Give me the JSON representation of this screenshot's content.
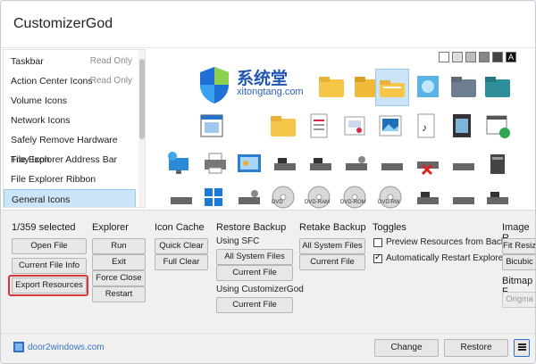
{
  "window": {
    "title": "CustomizerGod"
  },
  "watermark": {
    "brand": "系统堂",
    "url": "xitongtang.com"
  },
  "list": {
    "items": [
      {
        "label": "Taskbar",
        "badge": "Read Only"
      },
      {
        "label": "Action Center Icons",
        "badge": "Read Only"
      },
      {
        "label": "Volume Icons",
        "badge": ""
      },
      {
        "label": "Network Icons",
        "badge": ""
      },
      {
        "label": "Safely Remove Hardware Tray Icon",
        "badge": ""
      },
      {
        "label": "File Explorer Address Bar",
        "badge": ""
      },
      {
        "label": "File Explorer Ribbon",
        "badge": ""
      },
      {
        "label": "General Icons",
        "badge": "",
        "selected": true
      }
    ]
  },
  "size_buttons": [
    "",
    "",
    "",
    "",
    "",
    "A"
  ],
  "icon_labels": [
    "DVD",
    "DVD-RAM",
    "DVD-ROM",
    "DVD-RW"
  ],
  "panel": {
    "counter": "1/359 selected",
    "left_buttons": {
      "open": "Open File",
      "info": "Current File Info",
      "export": "Export Resources"
    },
    "explorer": {
      "title": "Explorer",
      "run": "Run",
      "exit": "Exit",
      "force_close": "Force Close",
      "restart": "Restart"
    },
    "icon_cache": {
      "title": "Icon Cache",
      "quick": "Quick Clear",
      "full": "Full Clear"
    },
    "restore_backup": {
      "title": "Restore Backup",
      "using_sfc": "Using SFC",
      "all_system": "All System Files",
      "current": "Current File",
      "using_cg": "Using CustomizerGod",
      "current2": "Current File"
    },
    "retake_backup": {
      "title": "Retake Backup",
      "all_system": "All System Files",
      "current": "Current File"
    },
    "toggles": {
      "title": "Toggles",
      "preview": "Preview Resources from Backup",
      "auto_restart": "Automatically Restart Explorer"
    },
    "image": {
      "title": "Image R",
      "fit": "Fit Resiz",
      "bicubic": "Bicubic",
      "bitmap": "Bitmap F",
      "original": "Origina"
    }
  },
  "footer": {
    "brand": "door2windows.com",
    "change": "Change",
    "restore": "Restore"
  },
  "colors": {
    "accent": "#cce4f7",
    "highlight": "#d8363a",
    "folder": "#f6c648"
  }
}
